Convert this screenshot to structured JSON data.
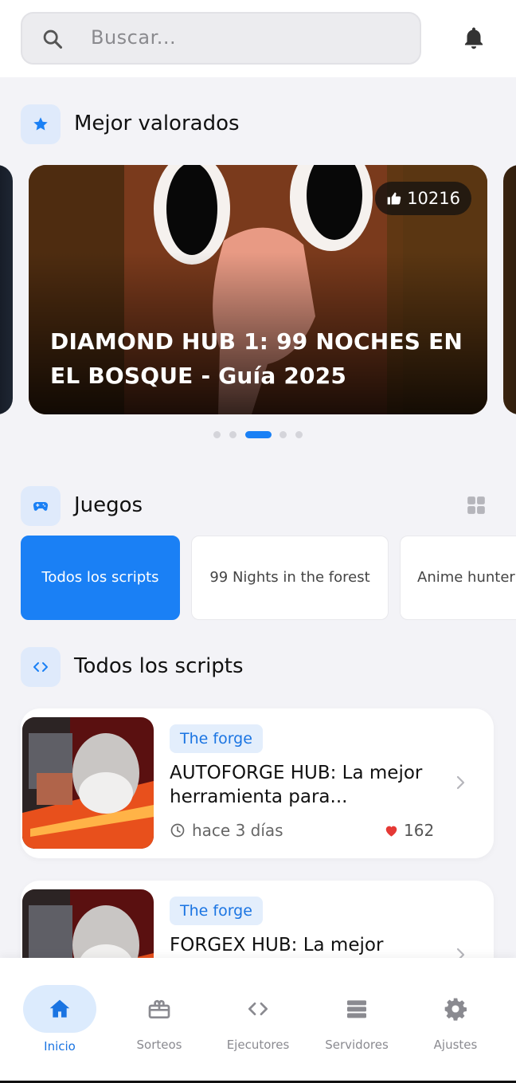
{
  "search": {
    "placeholder": "Buscar..."
  },
  "colors": {
    "accent": "#1a80f5",
    "accent_light": "#dcebfd",
    "like_red": "#e53935"
  },
  "top_rated": {
    "title": "Mejor valorados",
    "hero": {
      "likes": "10216",
      "title": "DIAMOND HUB 1: 99 NOCHES EN EL BOSQUE - Guía 2025"
    },
    "pager": {
      "count": 5,
      "active_index": 2
    }
  },
  "games": {
    "title": "Juegos",
    "chips": [
      {
        "label": "Todos los scripts",
        "active": true
      },
      {
        "label": "99 Nights in the forest",
        "active": false
      },
      {
        "label": "Anime hunter",
        "active": false
      }
    ]
  },
  "scripts": {
    "title": "Todos los scripts",
    "items": [
      {
        "tag": "The forge",
        "title": "AUTOFORGE HUB: La mejor herramienta para...",
        "time": "hace 3 días",
        "likes": "162"
      },
      {
        "tag": "The forge",
        "title": "FORGEX HUB: La mejor",
        "time": "",
        "likes": ""
      }
    ]
  },
  "nav": {
    "items": [
      {
        "label": "Inicio",
        "icon": "home-icon",
        "active": true
      },
      {
        "label": "Sorteos",
        "icon": "gift-icon",
        "active": false
      },
      {
        "label": "Ejecutores",
        "icon": "code-icon",
        "active": false
      },
      {
        "label": "Servidores",
        "icon": "servers-icon",
        "active": false
      },
      {
        "label": "Ajustes",
        "icon": "gear-icon",
        "active": false
      }
    ]
  }
}
